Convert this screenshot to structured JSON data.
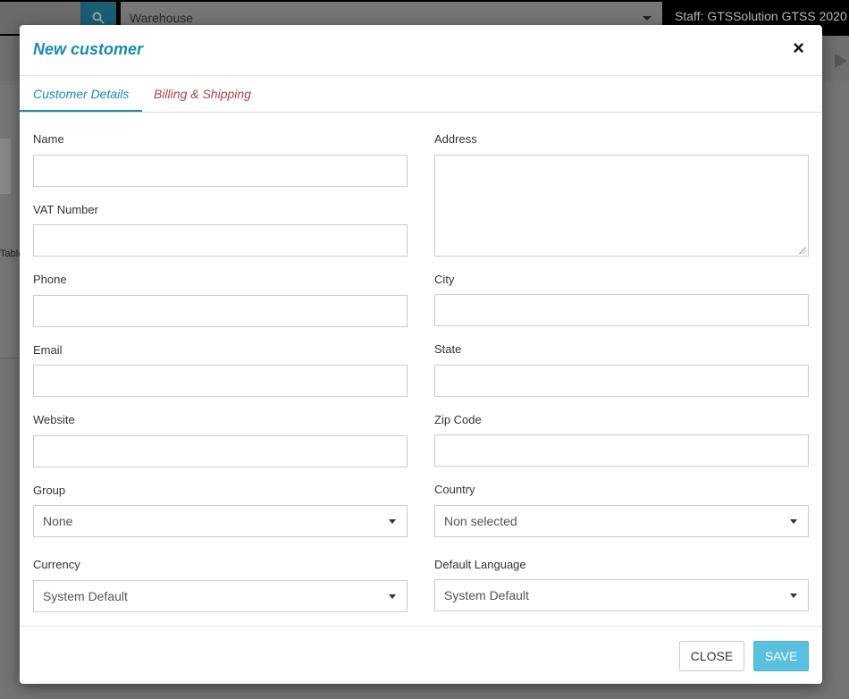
{
  "background": {
    "warehouse_select": "Warehouse",
    "staff_text": "Staff: GTSSolution GTSS   2020",
    "table_label": "Table"
  },
  "modal": {
    "title": "New customer",
    "close_icon": "×",
    "tabs": [
      "Customer Details",
      "Billing & Shipping"
    ],
    "fields": {
      "name": {
        "label": "Name",
        "value": ""
      },
      "vat": {
        "label": "VAT Number",
        "value": ""
      },
      "phone": {
        "label": "Phone",
        "value": ""
      },
      "email": {
        "label": "Email",
        "value": ""
      },
      "website": {
        "label": "Website",
        "value": ""
      },
      "group": {
        "label": "Group",
        "value": "None"
      },
      "currency": {
        "label": "Currency",
        "value": "System Default"
      },
      "address": {
        "label": "Address",
        "value": ""
      },
      "city": {
        "label": "City",
        "value": ""
      },
      "state": {
        "label": "State",
        "value": ""
      },
      "zip": {
        "label": "Zip Code",
        "value": ""
      },
      "country": {
        "label": "Country",
        "value": "Non selected"
      },
      "language": {
        "label": "Default Language",
        "value": "System Default"
      }
    },
    "footer": {
      "close_label": "CLOSE",
      "save_label": "SAVE"
    }
  },
  "colors": {
    "accent": "#1b8bad",
    "tab_inactive": "#a94442",
    "save_button": "#5bc0de"
  }
}
